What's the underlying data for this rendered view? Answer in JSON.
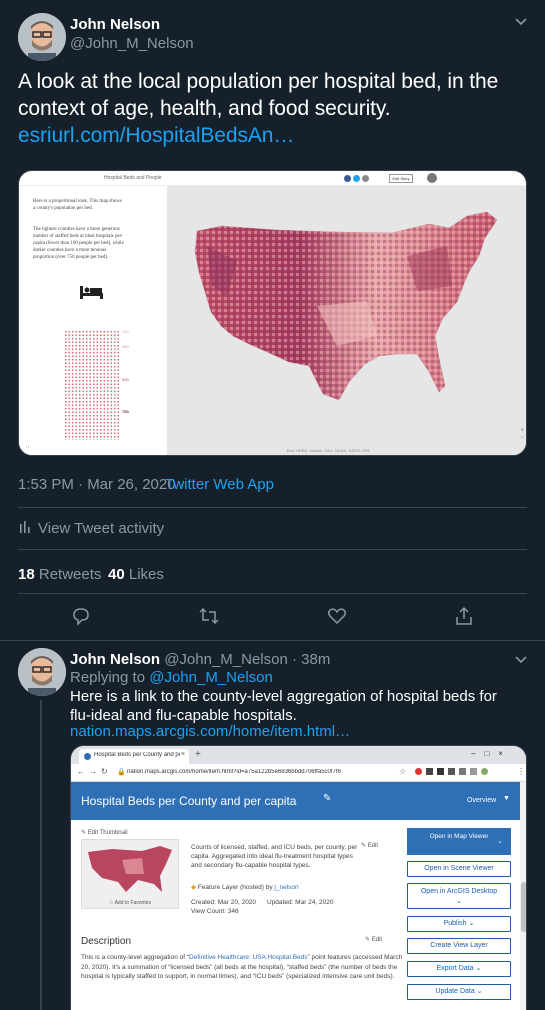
{
  "tweet1": {
    "name": "John Nelson",
    "handle": "@John_M_Nelson",
    "text": "A look at the local population per hospital bed, in the context of age, health, and food security.",
    "link": "esriurl.com/HospitalBedsAn…",
    "image": {
      "header_title": "Hospital Beds and People",
      "header_button": "Edit Story",
      "side_para1": "Here is a proportional look. This map shows a county's population per bed.",
      "side_para2": "The lightest counties have a more generous number of staffed beds at ideal hospitals per-capita (fewer than 100 people per bed), while darker counties have a more tenuous proportion (over 750 people per bed).",
      "legend_values": [
        "100",
        "250",
        "500",
        "750"
      ],
      "map_attribution": "Esri, HERE, Garmin, FAO, NOAA, USGS, EPA"
    },
    "timestamp": "1:53 PM · Mar 26, 2020 ·",
    "source": "Twitter Web App",
    "activity": "View Tweet activity",
    "retweets_count": "18",
    "retweets_label": "Retweets",
    "likes_count": "40",
    "likes_label": "Likes"
  },
  "tweet2": {
    "name": "John Nelson",
    "handle_time": "@John_M_Nelson · 38m",
    "replying_prefix": "Replying to",
    "replying_to": "@John_M_Nelson",
    "text": "Here is a link to the county-level aggregation of hospital beds for flu-ideal and flu-capable hospitals.",
    "link": "nation.maps.arcgis.com/home/item.html…",
    "browser": {
      "tab_title": "Hospital Beds per County and per c…",
      "url": "nation.maps.arcgis.com/home/item.html?id=a75a122b5e6836bbdd706ffa5c0f7f6",
      "page_title": "Hospital Beds per County and per capita",
      "overview": "Overview",
      "edit_thumbnail": "Edit Thumbnail",
      "add_favorites": "Add to Favorites",
      "summary": "Counts of licensed, staffed, and ICU beds, per county, per capita. Aggregated into ideal flu-treatment hospital types and secondary flu-capable hospital types.",
      "edit": "Edit",
      "feature_layer": "Feature Layer (hosted) by",
      "feature_owner": "j_nelson",
      "created": "Created: Mar 20, 2020",
      "updated": "Updated: Mar 24, 2020",
      "view_count": "View Count: 346",
      "description_label": "Description",
      "description_edit": "Edit",
      "description_pre": "This is a county-level aggregation of “",
      "description_link": "Definitive Healthcare: USA Hospital Beds",
      "description_post": "” point features (accessed March 20, 2020). It's a summation of “licensed beds” (all beds at the hospital), “staffed beds” (the number of beds the hospital is typically staffed to support, in normal times), and “ICU beds” (specialized intensive care unit beds).",
      "buttons": [
        "Open in Map Viewer",
        "Open in Scene Viewer",
        "Open in ArcGIS Desktop",
        "Publish",
        "Create View Layer",
        "Export Data",
        "Update Data"
      ]
    }
  },
  "colors": {
    "bg": "#15202b",
    "accent": "#1da1f2",
    "muted": "#8899a6",
    "esri_blue": "#2f6fb5"
  }
}
